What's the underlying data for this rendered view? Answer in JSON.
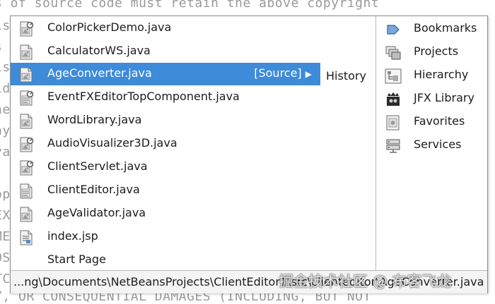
{
  "background_code": [
    "s of source code must retain the above copyright",
    "is",
    "s",
    "is",
    "id",
    "ne",
    "ay",
    "va",
    "",
    "op",
    "EX",
    "ME",
    "OS",
    "",
    "TC",
    "Y, OR CONSEQUENTIAL DAMAGES (INCLUDING, BUT NOT"
  ],
  "files": [
    {
      "name": "ColorPickerDemo.java",
      "icon": "java-file-modified-icon",
      "selected": false
    },
    {
      "name": "CalculatorWS.java",
      "icon": "java-file-icon",
      "selected": false
    },
    {
      "name": "AgeConverter.java",
      "icon": "java-file-icon",
      "selected": true,
      "source_label": "[Source]",
      "arrow": "▶"
    },
    {
      "name": "EventFXEditorTopComponent.java",
      "icon": "java-form-modified-icon",
      "selected": false
    },
    {
      "name": "WordLibrary.java",
      "icon": "java-file-icon",
      "selected": false
    },
    {
      "name": "AudioVisualizer3D.java",
      "icon": "java-file-modified-icon",
      "selected": false
    },
    {
      "name": "ClientServlet.java",
      "icon": "java-file-modified-icon",
      "selected": false
    },
    {
      "name": "ClientEditor.java",
      "icon": "java-form-icon",
      "selected": false
    },
    {
      "name": "AgeValidator.java",
      "icon": "java-file-icon",
      "selected": false
    },
    {
      "name": "index.jsp",
      "icon": "jsp-file-icon",
      "selected": false
    },
    {
      "name": "Start Page",
      "icon": "",
      "selected": false
    }
  ],
  "history_label": "History",
  "windows": [
    {
      "name": "Bookmarks",
      "icon": "bookmarks-icon"
    },
    {
      "name": "Projects",
      "icon": "projects-icon"
    },
    {
      "name": "Hierarchy",
      "icon": "hierarchy-icon"
    },
    {
      "name": "JFX Library",
      "icon": "jfx-library-icon"
    },
    {
      "name": "Favorites",
      "icon": "favorites-icon"
    },
    {
      "name": "Services",
      "icon": "services-icon"
    }
  ],
  "path": "...ng\\Documents\\NetBeansProjects\\ClientEditor1\\src\\clienteditor\\AgeConverter.java",
  "watermark": "掘金技术社区 @ 布客飞龙",
  "colors": {
    "selection": "#3d8bd9",
    "border": "#8e8e8e",
    "path_bar": "#f4f4f4"
  }
}
